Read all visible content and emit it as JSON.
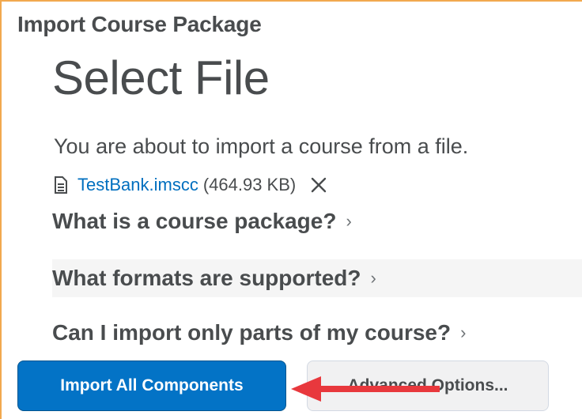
{
  "page": {
    "title": "Import Course Package",
    "heading": "Select File",
    "intro": "You are about to import a course from a file."
  },
  "file": {
    "icon": "document-icon",
    "name": "TestBank.imscc",
    "size": "(464.93 KB)",
    "remove_icon": "close-icon"
  },
  "faq": [
    {
      "label": "What is a course package?",
      "chevron": "›"
    },
    {
      "label": "What formats are supported?",
      "chevron": "›"
    },
    {
      "label": "Can I import only parts of my course?",
      "chevron": "›"
    }
  ],
  "buttons": {
    "primary": "Import All Components",
    "secondary": "Advanced Options..."
  },
  "annotation": {
    "arrow_color": "#e8383d",
    "arrow_icon": "arrow-left-icon"
  },
  "colors": {
    "accent_border": "#f2a94e",
    "link": "#006fbf",
    "primary_button": "#0373c6",
    "text": "#494c4e"
  }
}
